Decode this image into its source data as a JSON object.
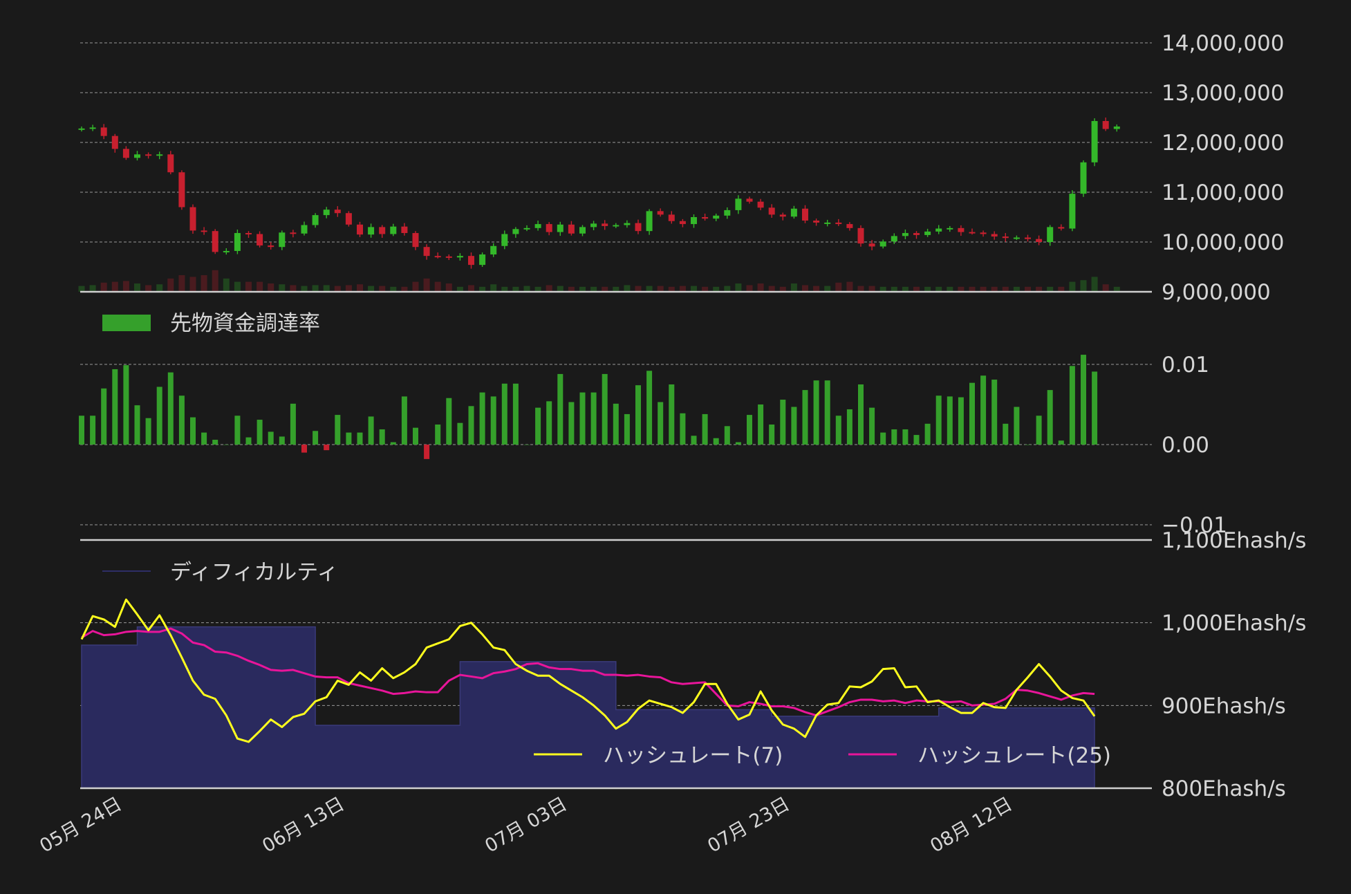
{
  "colors": {
    "background": "#1a1a1a",
    "up": "#34b82a",
    "down": "#c8202f",
    "funding_pos": "#35a02b",
    "funding_neg": "#c8202f",
    "hash7": "#ffff1e",
    "hash25": "#e8159a",
    "difficulty_fill": "#2a2a5e"
  },
  "chart_data": [
    {
      "type": "candlestick",
      "title": "",
      "y_ticks": [
        "14,000,000",
        "13,000,000",
        "12,000,000",
        "11,000,000",
        "10,000,000",
        "9,000,000"
      ],
      "y_tick_values": [
        14000000,
        13000000,
        12000000,
        11000000,
        10000000,
        9000000
      ],
      "ylim": [
        9000000,
        14000000
      ],
      "grid": true,
      "start_date": "05-24",
      "ohlc_close": [
        12280000,
        12300000,
        12130000,
        11870000,
        11690000,
        11760000,
        11740000,
        11760000,
        11400000,
        10700000,
        10230000,
        10220000,
        9800000,
        9820000,
        10180000,
        10160000,
        9930000,
        9900000,
        10190000,
        10170000,
        10340000,
        10540000,
        10650000,
        10580000,
        10350000,
        10150000,
        10300000,
        10160000,
        10310000,
        10180000,
        9900000,
        9720000,
        9710000,
        9690000,
        9720000,
        9540000,
        9750000,
        9920000,
        10160000,
        10260000,
        10280000,
        10360000,
        10200000,
        10350000,
        10170000,
        10300000,
        10370000,
        10320000,
        10340000,
        10380000,
        10220000,
        10620000,
        10550000,
        10420000,
        10360000,
        10500000,
        10470000,
        10530000,
        10640000,
        10870000,
        10810000,
        10690000,
        10550000,
        10510000,
        10670000,
        10430000,
        10390000,
        10390000,
        10360000,
        10280000,
        9970000,
        9910000,
        10010000,
        10120000,
        10180000,
        10140000,
        10210000,
        10270000,
        10280000,
        10200000,
        10190000,
        10160000,
        10110000,
        10080000,
        10090000,
        10060000,
        10000000,
        10300000,
        10270000,
        10970000,
        11600000,
        12430000,
        12270000,
        12320000
      ],
      "series": [
        {
          "name": "volume",
          "values": [
            0.35,
            0.4,
            0.55,
            0.6,
            0.65,
            0.5,
            0.4,
            0.45,
            0.8,
            1.0,
            0.9,
            1.0,
            1.3,
            0.8,
            0.6,
            0.6,
            0.6,
            0.5,
            0.45,
            0.4,
            0.35,
            0.4,
            0.4,
            0.35,
            0.4,
            0.45,
            0.35,
            0.35,
            0.3,
            0.3,
            0.6,
            0.8,
            0.6,
            0.5,
            0.3,
            0.4,
            0.3,
            0.45,
            0.3,
            0.3,
            0.35,
            0.3,
            0.4,
            0.35,
            0.3,
            0.3,
            0.3,
            0.3,
            0.3,
            0.4,
            0.35,
            0.35,
            0.35,
            0.3,
            0.35,
            0.35,
            0.3,
            0.3,
            0.35,
            0.5,
            0.4,
            0.5,
            0.35,
            0.3,
            0.5,
            0.4,
            0.35,
            0.35,
            0.55,
            0.6,
            0.35,
            0.35,
            0.3,
            0.3,
            0.3,
            0.3,
            0.3,
            0.3,
            0.3,
            0.3,
            0.3,
            0.3,
            0.3,
            0.3,
            0.3,
            0.3,
            0.3,
            0.3,
            0.3,
            0.6,
            0.7,
            0.9,
            0.45,
            0.3
          ]
        }
      ]
    },
    {
      "type": "bar",
      "title": "",
      "legend": [
        "先物資金調達率"
      ],
      "legend_placement": "top-left",
      "y_ticks": [
        "0.01",
        "0.00",
        "−0.01"
      ],
      "y_tick_values": [
        0.01,
        0.0,
        -0.01
      ],
      "ylim": [
        -0.01,
        0.01
      ],
      "grid": true,
      "values": [
        0.0036,
        0.0036,
        0.007,
        0.0094,
        0.0099,
        0.0049,
        0.0033,
        0.0072,
        0.009,
        0.0061,
        0.0034,
        0.0015,
        0.0006,
        0.0,
        0.0036,
        0.0009,
        0.0031,
        0.0016,
        0.001,
        0.0051,
        -0.001,
        0.0017,
        -0.0007,
        0.0037,
        0.0015,
        0.0015,
        0.0035,
        0.0019,
        0.0003,
        0.006,
        0.0021,
        -0.0018,
        0.0025,
        0.0058,
        0.0027,
        0.0048,
        0.0065,
        0.006,
        0.0076,
        0.0076,
        0.0,
        0.0046,
        0.0054,
        0.0088,
        0.0053,
        0.0065,
        0.0065,
        0.0088,
        0.0051,
        0.0038,
        0.0074,
        0.0092,
        0.0053,
        0.0075,
        0.0039,
        0.0011,
        0.0038,
        0.0008,
        0.0023,
        0.0003,
        0.0037,
        0.005,
        0.0025,
        0.0056,
        0.0047,
        0.0068,
        0.008,
        0.008,
        0.0036,
        0.0044,
        0.0075,
        0.0046,
        0.0015,
        0.0019,
        0.0019,
        0.0012,
        0.0026,
        0.0061,
        0.006,
        0.0059,
        0.0077,
        0.0086,
        0.0081,
        0.0026,
        0.0047,
        0.0,
        0.0036,
        0.0068,
        0.0005,
        0.0098,
        0.0112,
        0.0091
      ]
    },
    {
      "type": "line",
      "title": "",
      "y_ticks": [
        "1,100Ehash/s",
        "1,000Ehash/s",
        "900Ehash/s",
        "800Ehash/s"
      ],
      "y_tick_values": [
        1100,
        1000,
        900,
        800
      ],
      "ylim": [
        800,
        1100
      ],
      "grid": true,
      "x_ticks": [
        "05月 24日",
        "06月 13日",
        "07月 03日",
        "07月 23日",
        "08月 12日"
      ],
      "x_tick_index": [
        0,
        20,
        40,
        60,
        80
      ],
      "legend_placement": "bottom-right",
      "series": [
        {
          "name": "ディフィカルティ",
          "kind": "area",
          "values": [
            973,
            973,
            973,
            973,
            973,
            995,
            995,
            995,
            995,
            995,
            995,
            995,
            995,
            995,
            995,
            995,
            995,
            995,
            995,
            995,
            995,
            876,
            876,
            876,
            876,
            876,
            876,
            876,
            876,
            876,
            876,
            876,
            876,
            876,
            953,
            953,
            953,
            953,
            953,
            953,
            953,
            953,
            953,
            953,
            953,
            953,
            953,
            953,
            895,
            895,
            895,
            895,
            895,
            895,
            895,
            895,
            895,
            895,
            895,
            895,
            895,
            895,
            887,
            887,
            887,
            887,
            887,
            887,
            887,
            887,
            887,
            887,
            887,
            887,
            887,
            887,
            887,
            897,
            897,
            897,
            897,
            897,
            897,
            897,
            897,
            897,
            897,
            897,
            897,
            897,
            897,
            897
          ]
        },
        {
          "name": "ハッシュレート(7)",
          "kind": "line",
          "values": [
            980,
            1008,
            1004,
            995,
            1028,
            1010,
            991,
            1009,
            985,
            958,
            930,
            913,
            908,
            888,
            860,
            856,
            869,
            883,
            874,
            886,
            890,
            905,
            910,
            930,
            925,
            940,
            930,
            945,
            933,
            940,
            950,
            970,
            975,
            980,
            996,
            1000,
            986,
            970,
            967,
            950,
            942,
            936,
            936,
            926,
            918,
            910,
            900,
            888,
            872,
            880,
            896,
            906,
            902,
            898,
            891,
            904,
            926,
            926,
            902,
            883,
            889,
            917,
            894,
            877,
            872,
            862,
            888,
            901,
            903,
            923,
            922,
            929,
            944,
            945,
            922,
            923,
            904,
            906,
            898,
            891,
            891,
            903,
            898,
            897,
            919,
            934,
            950,
            935,
            918,
            909,
            906,
            887
          ]
        },
        {
          "name": "ハッシュレート(25)",
          "kind": "line",
          "values": [
            982,
            990,
            985,
            986,
            989,
            990,
            989,
            989,
            993,
            987,
            976,
            973,
            965,
            964,
            960,
            954,
            949,
            943,
            942,
            943,
            939,
            935,
            934,
            934,
            927,
            924,
            921,
            918,
            914,
            915,
            917,
            916,
            916,
            930,
            937,
            935,
            933,
            939,
            941,
            944,
            950,
            951,
            946,
            944,
            944,
            942,
            942,
            937,
            937,
            936,
            937,
            935,
            934,
            928,
            926,
            927,
            928,
            914,
            900,
            899,
            904,
            902,
            899,
            899,
            897,
            892,
            888,
            893,
            898,
            904,
            907,
            907,
            905,
            906,
            903,
            906,
            905,
            905,
            904,
            905,
            900,
            901,
            902,
            908,
            919,
            918,
            915,
            911,
            907,
            912,
            915,
            914
          ]
        }
      ]
    }
  ]
}
